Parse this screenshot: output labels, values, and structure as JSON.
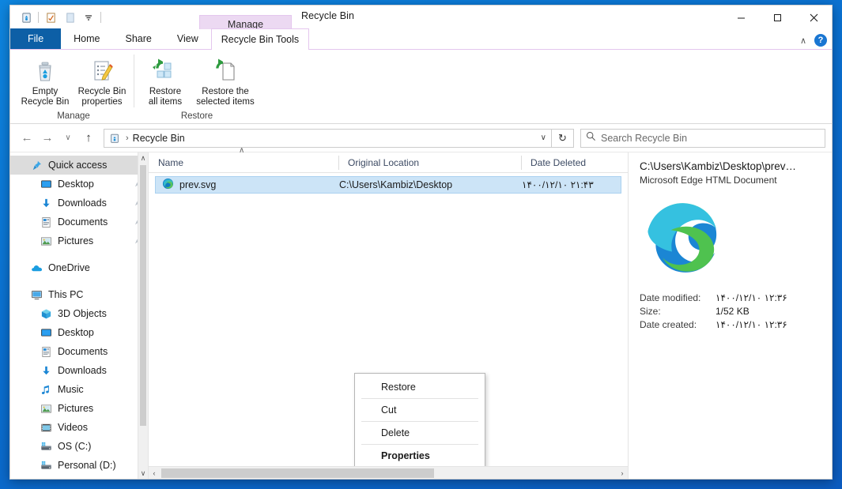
{
  "window": {
    "title": "Recycle Bin",
    "minimize_label": "─",
    "maximize_label": "□",
    "close_label": "✕"
  },
  "quick_access_toolbar": {
    "items": [
      {
        "name": "recycle-bin-icon",
        "label": "Recycle Bin"
      },
      {
        "name": "properties-icon",
        "label": "Recycle Bin properties"
      },
      {
        "name": "empty-page-icon",
        "label": "Customize"
      },
      {
        "name": "chevron-down-icon",
        "label": "Customize Quick Access Toolbar"
      }
    ]
  },
  "ribbon": {
    "contextual_tab_header": "Manage",
    "tabs": [
      {
        "id": "file",
        "label": "File"
      },
      {
        "id": "home",
        "label": "Home"
      },
      {
        "id": "share",
        "label": "Share"
      },
      {
        "id": "view",
        "label": "View"
      },
      {
        "id": "recycle-bin-tools",
        "label": "Recycle Bin Tools"
      }
    ],
    "collapse_label": "∧",
    "help_label": "?",
    "groups": [
      {
        "id": "manage",
        "label": "Manage",
        "buttons": [
          {
            "id": "empty-recycle-bin",
            "line1": "Empty",
            "line2": "Recycle Bin"
          },
          {
            "id": "recycle-bin-properties",
            "line1": "Recycle Bin",
            "line2": "properties"
          }
        ]
      },
      {
        "id": "restore",
        "label": "Restore",
        "buttons": [
          {
            "id": "restore-all-items",
            "line1": "Restore",
            "line2": "all items"
          },
          {
            "id": "restore-selected-items",
            "line1": "Restore the",
            "line2": "selected items"
          }
        ]
      }
    ]
  },
  "address_bar": {
    "back_label": "←",
    "forward_label": "→",
    "recent_label": "∨",
    "up_label": "↑",
    "crumb_separator": "›",
    "path_label": "Recycle Bin",
    "dropdown_label": "∨",
    "refresh_label": "↻"
  },
  "search": {
    "placeholder": "Search Recycle Bin",
    "value": ""
  },
  "sidebar": {
    "scroll_up_label": "∧",
    "scroll_down_label": "∨",
    "items": [
      {
        "id": "quick-access",
        "label": "Quick access",
        "icon": "pin-star-icon",
        "level": 0,
        "selected": true,
        "pinned": false
      },
      {
        "id": "qa-desktop",
        "label": "Desktop",
        "icon": "desktop-icon",
        "level": 1,
        "selected": false,
        "pinned": true
      },
      {
        "id": "qa-downloads",
        "label": "Downloads",
        "icon": "download-icon",
        "level": 1,
        "selected": false,
        "pinned": true
      },
      {
        "id": "qa-documents",
        "label": "Documents",
        "icon": "document-icon",
        "level": 1,
        "selected": false,
        "pinned": true
      },
      {
        "id": "qa-pictures",
        "label": "Pictures",
        "icon": "picture-icon",
        "level": 1,
        "selected": false,
        "pinned": true
      },
      {
        "id": "onedrive",
        "label": "OneDrive",
        "icon": "cloud-icon",
        "level": 0,
        "selected": false,
        "pinned": false,
        "gap_before": true
      },
      {
        "id": "this-pc",
        "label": "This PC",
        "icon": "monitor-icon",
        "level": 0,
        "selected": false,
        "pinned": false,
        "gap_before": true
      },
      {
        "id": "pc-3d-objects",
        "label": "3D Objects",
        "icon": "cube-icon",
        "level": 1,
        "selected": false,
        "pinned": false
      },
      {
        "id": "pc-desktop",
        "label": "Desktop",
        "icon": "desktop-icon",
        "level": 1,
        "selected": false,
        "pinned": false
      },
      {
        "id": "pc-documents",
        "label": "Documents",
        "icon": "document-icon",
        "level": 1,
        "selected": false,
        "pinned": false
      },
      {
        "id": "pc-downloads",
        "label": "Downloads",
        "icon": "download-icon",
        "level": 1,
        "selected": false,
        "pinned": false
      },
      {
        "id": "pc-music",
        "label": "Music",
        "icon": "music-icon",
        "level": 1,
        "selected": false,
        "pinned": false
      },
      {
        "id": "pc-pictures",
        "label": "Pictures",
        "icon": "picture-icon",
        "level": 1,
        "selected": false,
        "pinned": false
      },
      {
        "id": "pc-videos",
        "label": "Videos",
        "icon": "video-icon",
        "level": 1,
        "selected": false,
        "pinned": false
      },
      {
        "id": "pc-os-c",
        "label": "OS (C:)",
        "icon": "drive-icon",
        "level": 1,
        "selected": false,
        "pinned": false
      },
      {
        "id": "pc-personal-d",
        "label": "Personal (D:)",
        "icon": "drive-icon",
        "level": 1,
        "selected": false,
        "pinned": false
      }
    ]
  },
  "file_list": {
    "sort_indicator": "∧",
    "columns": [
      {
        "id": "name",
        "label": "Name"
      },
      {
        "id": "original-location",
        "label": "Original Location"
      },
      {
        "id": "date-deleted",
        "label": "Date Deleted"
      }
    ],
    "rows": [
      {
        "id": "prev-svg",
        "name": "prev.svg",
        "icon": "edge-browser-icon",
        "original_location": "C:\\Users\\Kambiz\\Desktop",
        "date_deleted": "۱۴۰۰/۱۲/۱۰ ۲۱:۴۳",
        "selected": true
      }
    ],
    "hscroll_left_label": "‹",
    "hscroll_right_label": "›"
  },
  "context_menu": {
    "items": [
      {
        "id": "restore",
        "label": "Restore",
        "bold": false
      },
      {
        "id": "cut",
        "label": "Cut",
        "bold": false
      },
      {
        "id": "delete",
        "label": "Delete",
        "bold": false
      },
      {
        "id": "properties",
        "label": "Properties",
        "bold": true
      }
    ]
  },
  "details_pane": {
    "title": "C:\\Users\\Kambiz\\Desktop\\prev…",
    "subtitle": "Microsoft Edge HTML Document",
    "icon": "edge-browser-icon",
    "properties": [
      {
        "id": "date-modified",
        "key": "Date modified:",
        "value": "۱۴۰۰/۱۲/۱۰ ۱۲:۳۶"
      },
      {
        "id": "size",
        "key": "Size:",
        "value": "1/52 KB"
      },
      {
        "id": "date-created",
        "key": "Date created:",
        "value": "۱۴۰۰/۱۲/۱۰ ۱۲:۳۶"
      }
    ]
  },
  "colors": {
    "accent": "#0d5fa6",
    "contextual_tab": "#ecd9f2",
    "selection": "#cce4f7",
    "desktop": "#0b72d4"
  }
}
